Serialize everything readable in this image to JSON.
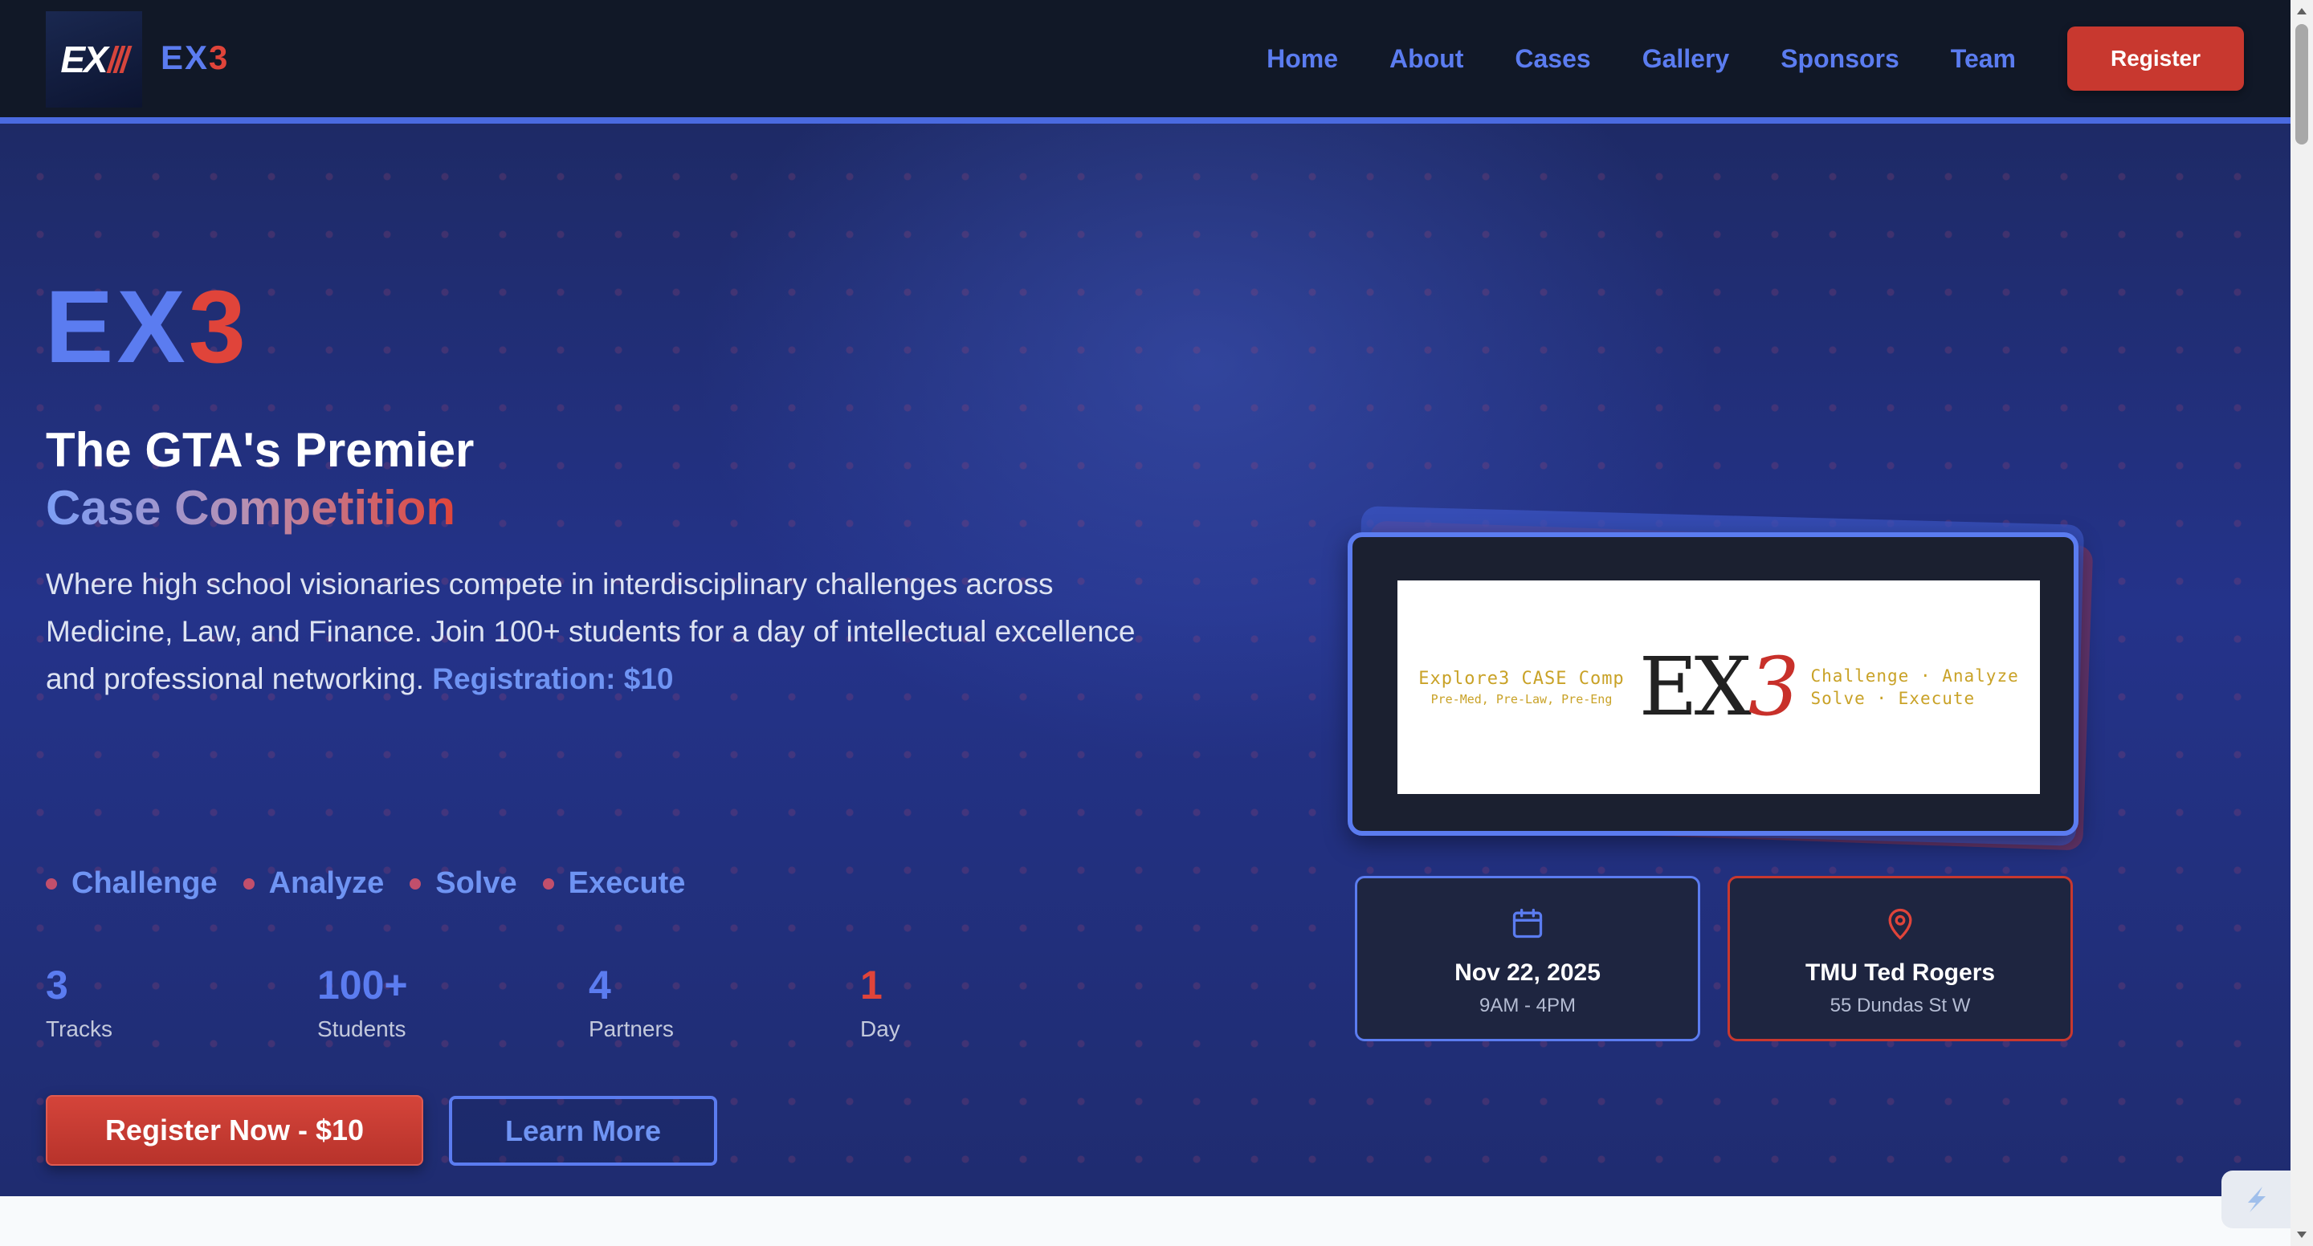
{
  "nav": {
    "logo_text": "EX",
    "brand_ex": "EX",
    "brand_three": "3",
    "links": [
      "Home",
      "About",
      "Cases",
      "Gallery",
      "Sponsors",
      "Team"
    ],
    "register_label": "Register"
  },
  "hero": {
    "title_ex": "EX",
    "title_three": "3",
    "subtitle_line1": "The GTA's Premier",
    "subtitle_line2": "Case Competition",
    "description": "Where high school visionaries compete in interdisciplinary challenges across Medicine, Law, and Finance. Join 100+ students for a day of intellectual excellence and professional networking.",
    "description_price": "Registration: $10",
    "pills": [
      "Challenge",
      "Analyze",
      "Solve",
      "Execute"
    ],
    "stats": [
      {
        "value": "3",
        "label": "Tracks"
      },
      {
        "value": "100+",
        "label": "Students"
      },
      {
        "value": "4",
        "label": "Partners"
      },
      {
        "value": "1",
        "label": "Day"
      }
    ],
    "primary_button": "Register Now - $10",
    "secondary_button": "Learn More"
  },
  "banner": {
    "left_line1": "Explore3 CASE Comp",
    "left_line2": "Pre-Med, Pre-Law, Pre-Eng",
    "logo_ex": "EX",
    "logo_three": "3",
    "right_line1": "Challenge · Analyze",
    "right_line2": "Solve · Execute"
  },
  "event": {
    "date": "Nov 22, 2025",
    "time": "9AM - 4PM",
    "venue": "TMU Ted Rogers",
    "address": "55 Dundas St W"
  },
  "colors": {
    "accent_blue": "#5b7cf0",
    "accent_red": "#e0443a",
    "nav_bg": "#111827"
  },
  "icons": {
    "date": "calendar-icon",
    "venue": "map-pin-icon"
  }
}
